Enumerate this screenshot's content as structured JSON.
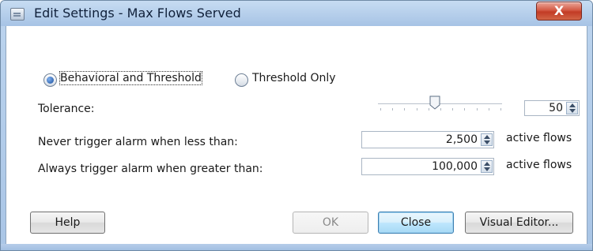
{
  "window": {
    "title": "Edit Settings - Max Flows Served",
    "close_label": "X"
  },
  "mode": {
    "options": [
      {
        "label": "Behavioral and Threshold",
        "selected": true
      },
      {
        "label": "Threshold Only",
        "selected": false
      }
    ]
  },
  "tolerance": {
    "label": "Tolerance:",
    "value": "50",
    "slider_level": 50
  },
  "never_trigger": {
    "label": "Never trigger alarm when less than:",
    "value": "2,500",
    "unit": "active flows"
  },
  "always_trigger": {
    "label": "Always trigger alarm when greater than:",
    "value": "100,000",
    "unit": "active flows"
  },
  "buttons": {
    "help": "Help",
    "ok": "OK",
    "close": "Close",
    "visual_editor": "Visual Editor..."
  },
  "icons": {
    "window_icon": "app-window-icon",
    "close": "close-icon",
    "spinner": "spinner-arrows-icon",
    "slider_thumb": "slider-thumb-icon"
  }
}
